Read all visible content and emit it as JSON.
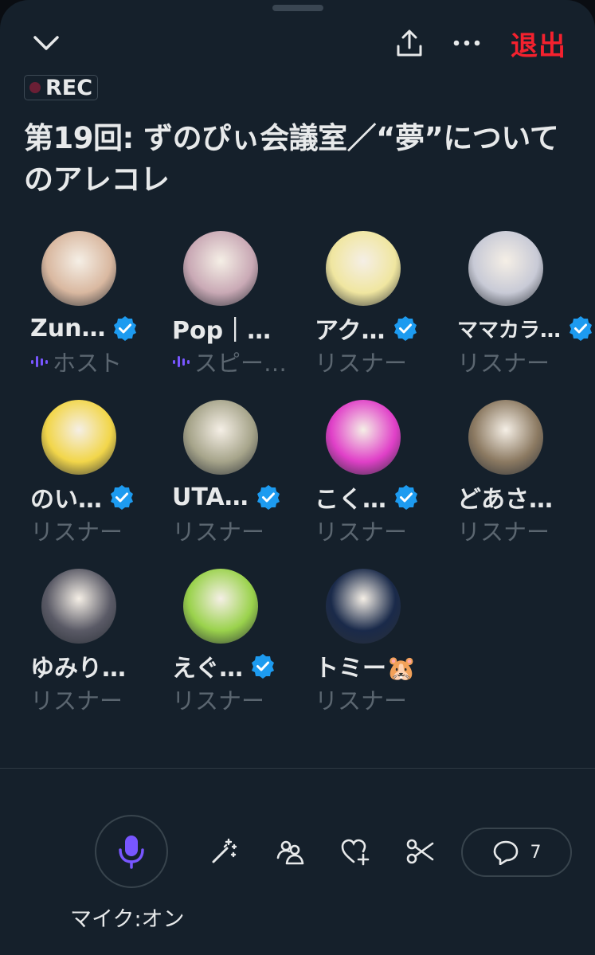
{
  "header": {
    "exit_label": "退出",
    "rec_label": "REC",
    "title": "第19回: ずのぴぃ会議室／“夢”についてのアレコレ"
  },
  "participants": [
    {
      "name": "Zun…",
      "role": "ホスト",
      "verified": true,
      "speaking": true,
      "avatar_color": "#d9b8a0"
    },
    {
      "name": "Pop｜…",
      "role": "スピー…",
      "verified": false,
      "speaking": true,
      "avatar_color": "#c9a9b5"
    },
    {
      "name": "アク…",
      "role": "リスナー",
      "verified": true,
      "speaking": false,
      "avatar_color": "#f0e6a0"
    },
    {
      "name": "ママカラ…",
      "role": "リスナー",
      "verified": true,
      "speaking": false,
      "avatar_color": "#c8cad6"
    },
    {
      "name": "のい…",
      "role": "リスナー",
      "verified": true,
      "speaking": false,
      "avatar_color": "#f2d64a"
    },
    {
      "name": "UTA…",
      "role": "リスナー",
      "verified": true,
      "speaking": false,
      "avatar_color": "#a6a48a"
    },
    {
      "name": "こく…",
      "role": "リスナー",
      "verified": true,
      "speaking": false,
      "avatar_color": "#e040c8"
    },
    {
      "name": "どあさ…",
      "role": "リスナー",
      "verified": false,
      "speaking": false,
      "avatar_color": "#8c7a62"
    },
    {
      "name": "ゆみり…",
      "role": "リスナー",
      "verified": false,
      "speaking": false,
      "avatar_color": "#5a5a66"
    },
    {
      "name": "えぐ…",
      "role": "リスナー",
      "verified": true,
      "speaking": false,
      "avatar_color": "#9ad24c"
    },
    {
      "name": "トミー🐹",
      "role": "リスナー",
      "verified": false,
      "speaking": false,
      "avatar_color": "#1a2a4a"
    }
  ],
  "controls": {
    "mic_label": "マイク:オン",
    "comment_count": "7"
  },
  "colors": {
    "background": "#15202b",
    "accent_purple": "#7856ff",
    "verified_blue": "#1d9bf0",
    "exit_red": "#f4212e"
  }
}
